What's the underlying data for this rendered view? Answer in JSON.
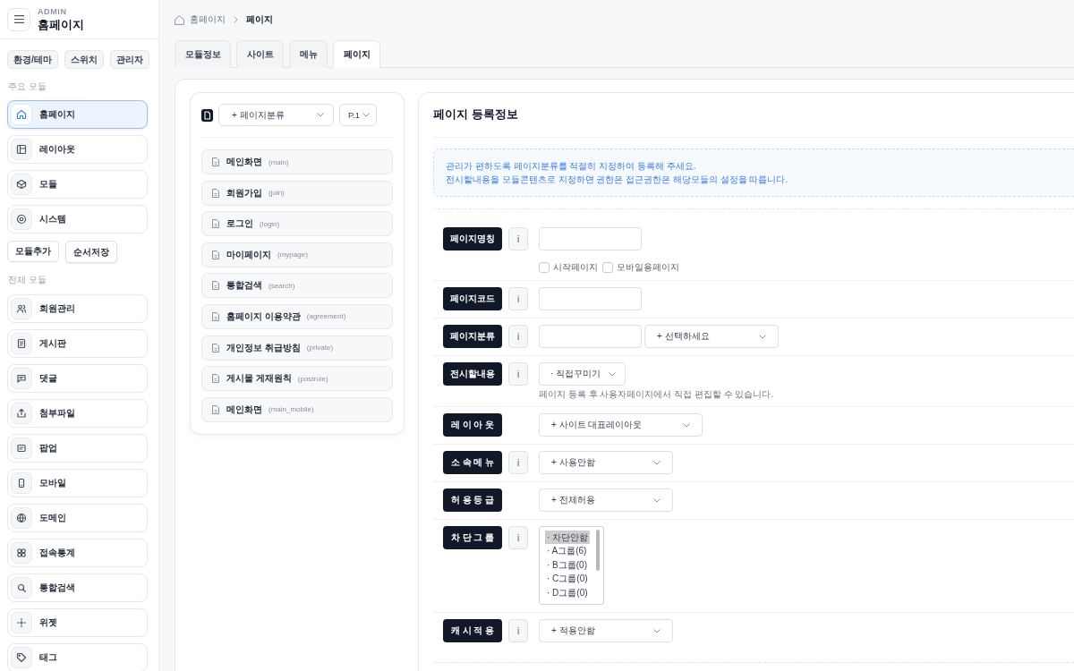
{
  "sidebar": {
    "caption": "ADMIN",
    "title": "홈페이지",
    "quick_buttons": [
      "환경/테마",
      "스위치",
      "관리자"
    ],
    "main_modules": {
      "heading": "주요 모듈",
      "items": [
        {
          "label": "홈페이지",
          "selected": true
        },
        {
          "label": "레이아웃",
          "selected": false
        },
        {
          "label": "모듈",
          "selected": false
        },
        {
          "label": "시스템",
          "selected": false
        }
      ]
    },
    "module_buttons": [
      "모듈추가",
      "순서저장"
    ],
    "all_modules": {
      "heading": "전체 모듈",
      "items": [
        {
          "label": "회원관리",
          "selected": false
        },
        {
          "label": "게시판",
          "selected": false
        },
        {
          "label": "댓글",
          "selected": false
        },
        {
          "label": "첨부파일",
          "selected": false
        },
        {
          "label": "팝업",
          "selected": false
        },
        {
          "label": "모바일",
          "selected": false
        },
        {
          "label": "도메인",
          "selected": false
        },
        {
          "label": "접속통계",
          "selected": false
        },
        {
          "label": "통합검색",
          "selected": false
        },
        {
          "label": "위젯",
          "selected": false
        },
        {
          "label": "태그",
          "selected": false
        }
      ]
    }
  },
  "breadcrumb": [
    {
      "label": "홈페이지",
      "current": false
    },
    {
      "label": "페이지",
      "current": true
    }
  ],
  "tabs": [
    {
      "label": "모듈정보",
      "selected": false
    },
    {
      "label": "사이트",
      "selected": false
    },
    {
      "label": "메뉴",
      "selected": false
    },
    {
      "label": "페이지",
      "selected": true
    }
  ],
  "page_list": {
    "category_select": "+ 페이지분류",
    "page_select": "P.1",
    "pages": [
      {
        "name": "메인화면",
        "code": "(main)"
      },
      {
        "name": "회원가입",
        "code": "(join)"
      },
      {
        "name": "로그인",
        "code": "(login)"
      },
      {
        "name": "마이페이지",
        "code": "(mypage)"
      },
      {
        "name": "통합검색",
        "code": "(search)"
      },
      {
        "name": "홈페이지 이용약관",
        "code": "(agreement)"
      },
      {
        "name": "개인정보 취급방침",
        "code": "(private)"
      },
      {
        "name": "게시물 게재원칙",
        "code": "(postrule)"
      },
      {
        "name": "메인화면",
        "code": "(main_mobile)"
      }
    ]
  },
  "form": {
    "title": "페이지 등록정보",
    "notice": [
      "관리가 편하도록 페이지분류를 적절히 지정하여 등록해 주세요.",
      "전시할내용을 모듈콘텐츠로 지정하면 권한은 접근권한은 해당모듈의 설정을 따릅니다."
    ],
    "rows": [
      {
        "kind": "text",
        "label": "페이지명칭",
        "info": "i",
        "checkboxes": [
          {
            "label": "시작페이지",
            "checked": false
          },
          {
            "label": "모바일용페이지",
            "checked": false
          }
        ]
      },
      {
        "kind": "text",
        "label": "페이지코드",
        "info": "i"
      },
      {
        "kind": "text_select",
        "label": "페이지분류",
        "info": "i",
        "select": "+ 선택하세요"
      },
      {
        "kind": "select",
        "label": "전시할내용",
        "info": "i",
        "select": "· 직접꾸미기",
        "hint": "페이지 등록 후 사용자페이지에서 직접 편집할 수 있습니다."
      },
      {
        "kind": "select",
        "label": "레 이 아 웃",
        "select": "+ 사이트 대표레이아웃"
      },
      {
        "kind": "select",
        "label": "소 속 메 뉴",
        "info": "i",
        "select": "+ 사용안함"
      },
      {
        "kind": "select",
        "label": "허 용 등 급",
        "select": "+ 전체허용"
      },
      {
        "kind": "listbox",
        "label": "차 단 그 룹",
        "info": "i",
        "options": [
          {
            "label": "· 차단안함",
            "selected": true
          },
          {
            "label": "· A그룹(6)",
            "selected": false
          },
          {
            "label": "· B그룹(0)",
            "selected": false
          },
          {
            "label": "· C그룹(0)",
            "selected": false
          },
          {
            "label": "· D그룹(0)",
            "selected": false
          }
        ]
      },
      {
        "kind": "select",
        "label": "캐 시 적 용",
        "info": "i",
        "select": "+ 적용안함"
      }
    ]
  }
}
